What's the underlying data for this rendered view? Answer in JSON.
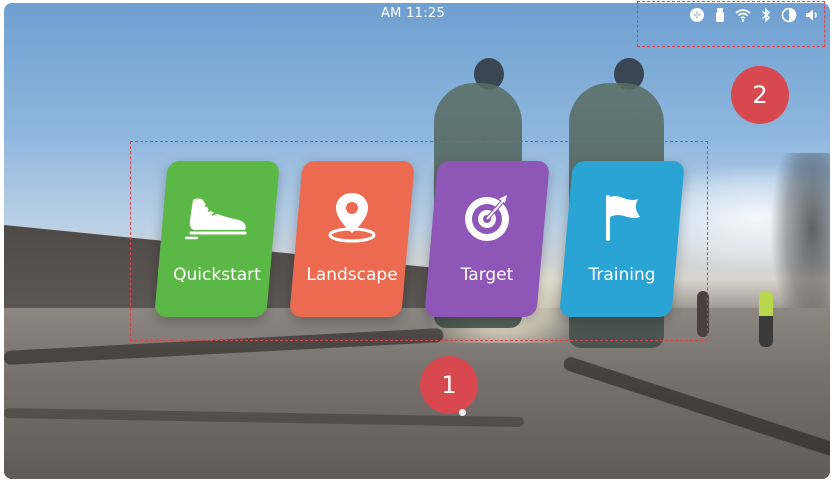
{
  "status_bar": {
    "time": "AM 11:25",
    "icons": [
      "fan-icon",
      "usb-icon",
      "wifi-icon",
      "bluetooth-icon",
      "brightness-icon",
      "volume-icon"
    ]
  },
  "callouts": {
    "one": "1",
    "two": "2"
  },
  "apps": [
    {
      "label": "Quickstart",
      "icon": "shoe-icon",
      "color": "#5cb846"
    },
    {
      "label": "Landscape",
      "icon": "location-pin-icon",
      "color": "#ec6a50"
    },
    {
      "label": "Target",
      "icon": "target-icon",
      "color": "#8e56b6"
    },
    {
      "label": "Training",
      "icon": "flag-icon",
      "color": "#2aa4d4"
    }
  ],
  "colors": {
    "callout": "#d8494f",
    "highlight_border": "#d9434a"
  }
}
